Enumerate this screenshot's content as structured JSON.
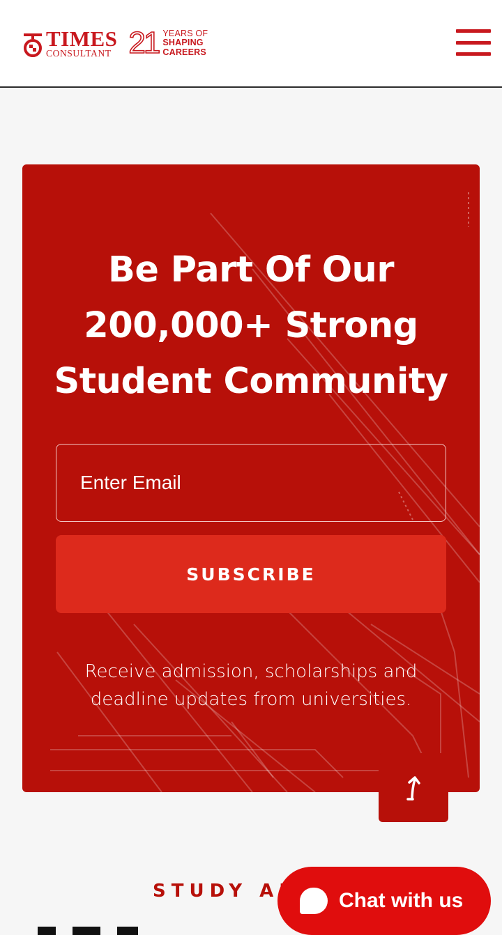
{
  "header": {
    "brand_name": "TIMES",
    "brand_sub": "CONSULTANT",
    "years_number": "21",
    "years_line1": "YEARS OF",
    "years_line2": "SHAPING",
    "years_line3": "CAREERS",
    "menu_icon": "hamburger-menu-icon"
  },
  "newsletter": {
    "heading_line1": "Be Part Of Our",
    "heading_line2": "200,000+ Strong",
    "heading_line3": "Student Community",
    "email_placeholder": "Enter Email",
    "subscribe_label": "SUBSCRIBE",
    "note_line1": "Receive admission, scholarships and",
    "note_line2": "deadline updates from universities."
  },
  "section": {
    "label": "STUDY AB"
  },
  "chat": {
    "label": "Chat with us",
    "icon": "chat-bubble-icon"
  },
  "scroll_top": {
    "icon": "arrow-up-icon"
  },
  "colors": {
    "brand_red": "#c8181e",
    "card_red": "#b71009",
    "button_red": "#dd2a1c",
    "chat_red": "#e00d0d"
  }
}
